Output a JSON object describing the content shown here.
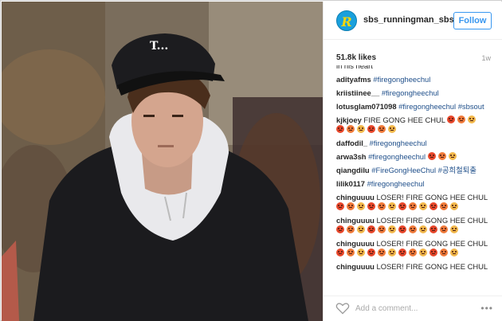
{
  "post": {
    "username": "sbs_runningman_sbs",
    "follow_label": "Follow",
    "likes": "51.8k likes",
    "time": "1w",
    "cap_text": "T...",
    "avatar_letter": "R"
  },
  "comments": [
    {
      "user": "",
      "text": "in his heart",
      "cut": true
    },
    {
      "user": "adityafms",
      "hashtag": "#firegongheechul"
    },
    {
      "user": "kriistiinee__",
      "hashtag": "#firegongheechul"
    },
    {
      "user": "lotusglam071098",
      "hashtag": "#firegongheechul #sbsout"
    },
    {
      "user": "kjkjoey",
      "text": "FIRE GONG HEE CHUL",
      "emojis_line1": 3,
      "emojis_line2": 6
    },
    {
      "user": "daffodil_",
      "hashtag": "#firegongheechul"
    },
    {
      "user": "arwa3sh",
      "hashtag": "#firegongheechul",
      "emojis_line1": 3
    },
    {
      "user": "qiangdilu",
      "hashtag": "#FireGongHeeChul #공희철퇴출"
    },
    {
      "user": "lilik0117",
      "hashtag": "#firegongheechul"
    },
    {
      "user": "chinguuuu",
      "text": "LOSER! FIRE GONG HEE CHUL",
      "emojis_line2": 12
    },
    {
      "user": "chinguuuu",
      "text": "LOSER! FIRE GONG HEE CHUL",
      "emojis_line2": 12
    },
    {
      "user": "chinguuuu",
      "text": "LOSER! FIRE GONG HEE CHUL",
      "emojis_line2": 12
    },
    {
      "user": "chinguuuu",
      "text": "LOSER! FIRE GONG HEE CHUL"
    }
  ],
  "footer": {
    "add_comment_placeholder": "Add a comment...",
    "more_label": "•••",
    "like_icon": "heart-icon"
  },
  "colors": {
    "follow_blue": "#3897f0",
    "hashtag": "#1f4f8a",
    "avatar_bg": "#1aa0dc",
    "avatar_letter": "#f5d60a"
  }
}
